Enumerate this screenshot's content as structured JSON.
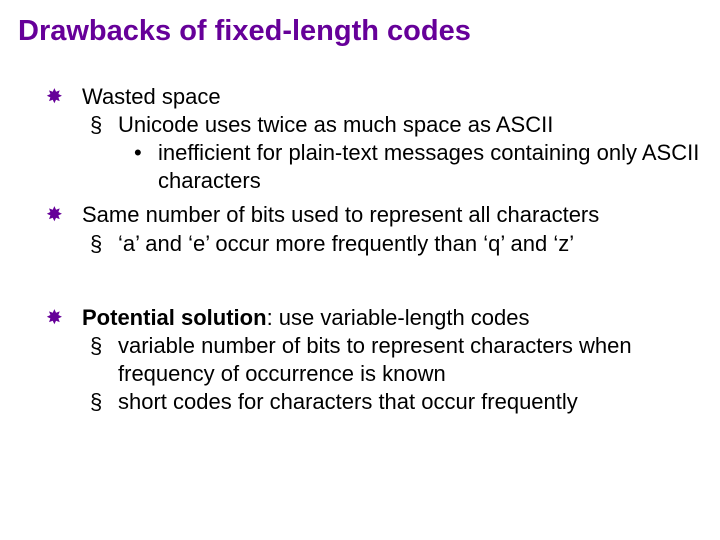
{
  "title": "Drawbacks of fixed-length codes",
  "points": [
    {
      "text": "Wasted space",
      "children": [
        {
          "text": "Unicode uses twice as much space as ASCII",
          "children": [
            {
              "text": "inefficient for plain-text messages containing only ASCII characters"
            }
          ]
        }
      ]
    },
    {
      "text": "Same number of bits used to represent all characters",
      "children": [
        {
          "text": "‘a’ and ‘e’ occur more frequently than ‘q’ and ‘z’"
        }
      ]
    },
    {
      "bold_prefix": "Potential solution",
      "text": ": use variable-length codes",
      "children": [
        {
          "text": "variable number of bits to represent characters when frequency of occurrence is known"
        },
        {
          "text": "short codes for characters that occur frequently"
        }
      ]
    }
  ]
}
